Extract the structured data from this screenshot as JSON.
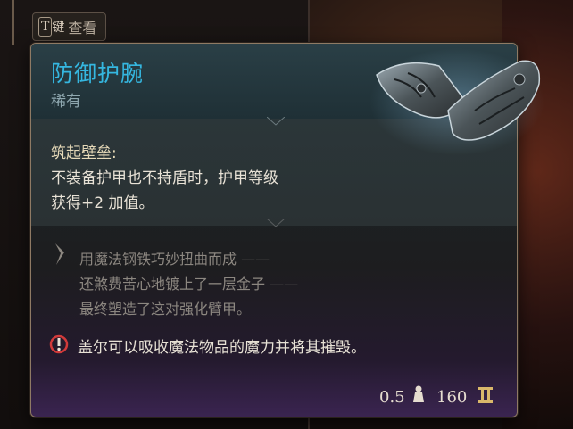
{
  "hint": {
    "key": "T",
    "key_suffix": "键",
    "label": "查看"
  },
  "item": {
    "name": "防御护腕",
    "rarity": "稀有",
    "effect_title": "筑起壁垒:",
    "effect_line1": "不装备护甲也不持盾时，护甲等级",
    "effect_line2": "获得+2 加值。",
    "lore": [
      "用魔法钢铁巧妙扭曲而成 ——",
      "还煞费苦心地镀上了一层金子 ——",
      "最终塑造了这对强化臂甲。"
    ],
    "warning": "盖尔可以吸收魔法物品的魔力并将其摧毁。",
    "weight": "0.5",
    "price": "160"
  },
  "colors": {
    "name": "#35b7e0",
    "rarity": "#8fa8b0",
    "effect_title": "#e6d9b8",
    "lore": "#8c8780",
    "warning_icon": "#d23a3a"
  },
  "icons": {
    "weight": "weight-icon",
    "gold": "gold-icon",
    "lore": "quill-icon",
    "warning": "gale-warning-icon",
    "item": "bracers-icon"
  }
}
